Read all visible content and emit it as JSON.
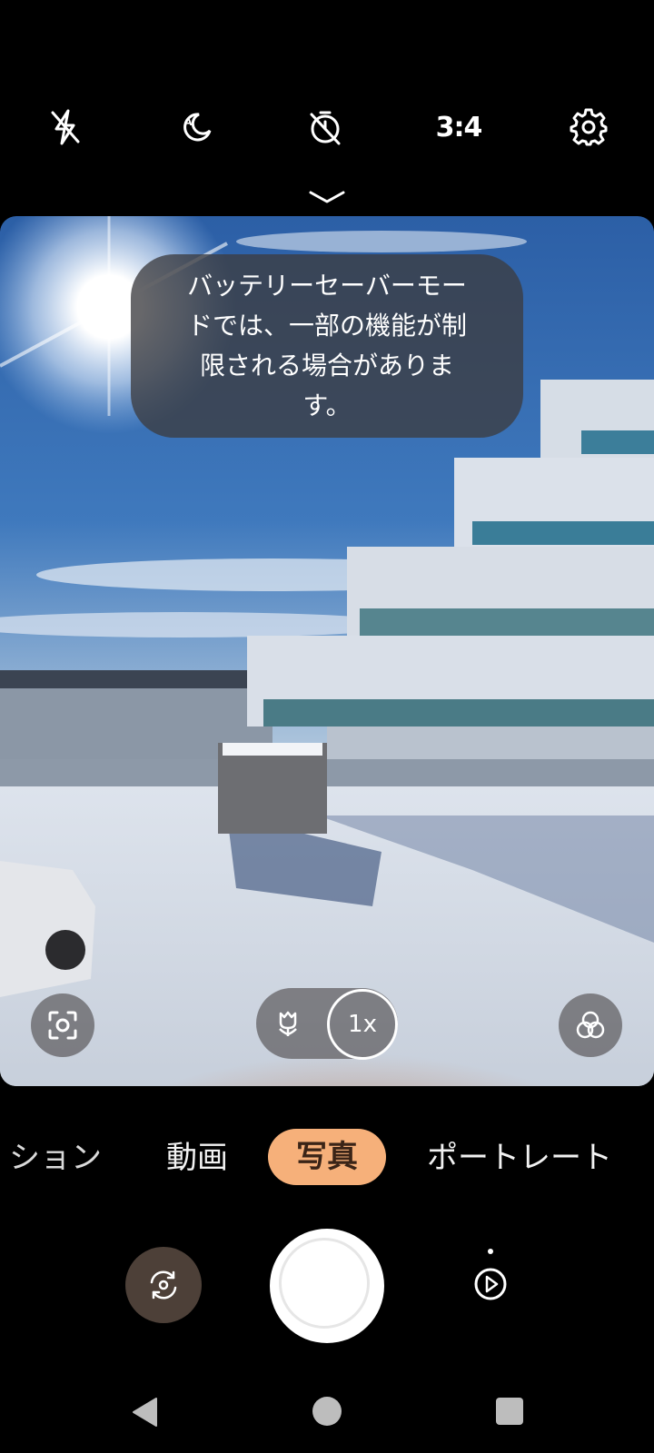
{
  "top_bar": {
    "flash_icon": "flash-off-icon",
    "night_icon": "auto-night-icon",
    "timer_icon": "timer-off-icon",
    "aspect_ratio": "3:4",
    "settings_icon": "gear-icon"
  },
  "viewfinder": {
    "toast": "バッテリーセーバーモー\nドでは、一部の機能が制\n限される場合がありま\nす。",
    "zoom_label": "1x",
    "macro_icon": "macro-flower-icon",
    "scan_icon": "scan-icon",
    "filter_icon": "filters-icon"
  },
  "modes": {
    "items": [
      "ション",
      "動画",
      "写真",
      "ポートレート"
    ],
    "active_index": 2,
    "active_color": "#f6b07a"
  },
  "controls": {
    "switch_camera_icon": "switch-camera-icon",
    "gallery_icon": "gallery-play-icon"
  }
}
